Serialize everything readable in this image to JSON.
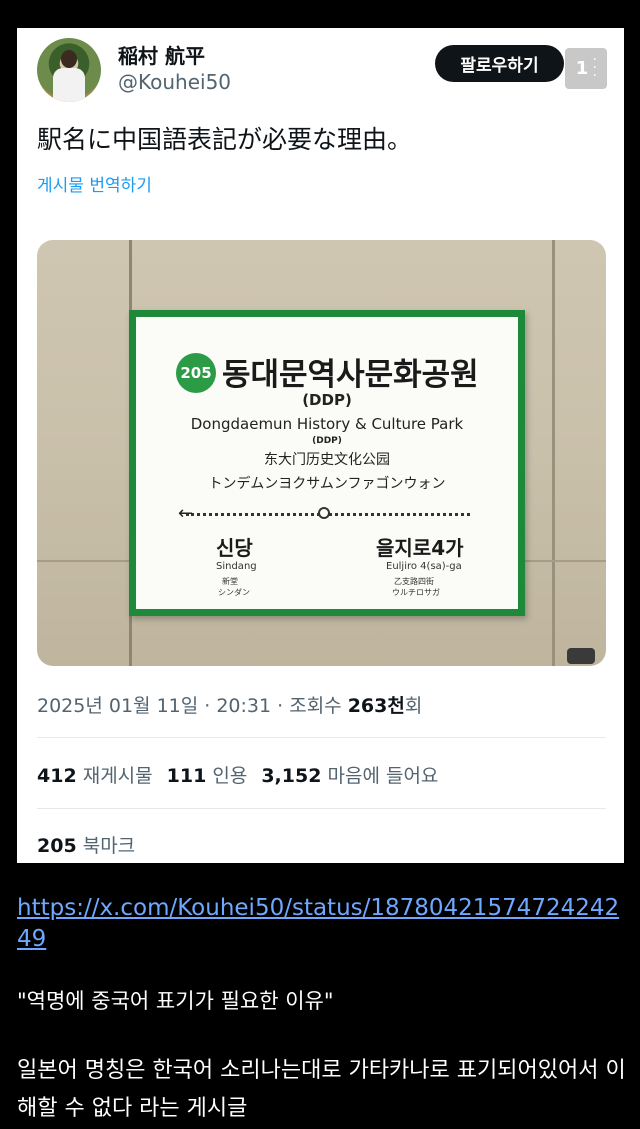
{
  "tweet": {
    "display_name": "稲村 航平",
    "handle": "@Kouhei50",
    "follow_label": "팔로우하기",
    "more_count": "1",
    "text": "駅名に中国語表記が必要な理由。",
    "translate_label": "게시물 번역하기",
    "timestamp": "2025년 01월 11일 · 20:31 · ",
    "views_label_prefix": "조회수 ",
    "views_value": "263천",
    "views_label_suffix": "회",
    "reposts_value": "412",
    "reposts_label": "재게시물",
    "quotes_value": "111",
    "quotes_label": "인용",
    "likes_value": "3,152",
    "likes_label": "마음에 들어요",
    "bookmarks_value": "205",
    "bookmarks_label": "북마크"
  },
  "sign": {
    "line_number": "205",
    "station_ko": "동대문역사문화공원",
    "station_ddp": "(DDP)",
    "station_en": "Dongdaemun History & Culture Park",
    "station_ddp_small": "(DDP)",
    "station_zh": "东大门历史文化公园",
    "station_ja": "トンデムンヨクサムンファゴンウォン",
    "left_ko": "신당",
    "left_en": "Sindang",
    "left_zh": "新堂",
    "left_ja": "シンダン",
    "right_ko": "을지로4가",
    "right_en": "Euljiro 4(sa)-ga",
    "right_zh": "乙支路四街",
    "right_ja": "ウルチロサガ",
    "line_color": "#2c9b45"
  },
  "post": {
    "link": "https://x.com/Kouhei50/status/1878042157472424249",
    "quote": "\"역명에 중국어 표기가 필요한 이유\"",
    "description": "일본어 명칭은 한국어 소리나는대로 가타카나로 표기되어있어서 이해할 수 없다 라는 게시글"
  },
  "colors": {
    "link": "#6ea8ff",
    "translate": "#1d9bf0",
    "background": "#000000"
  }
}
